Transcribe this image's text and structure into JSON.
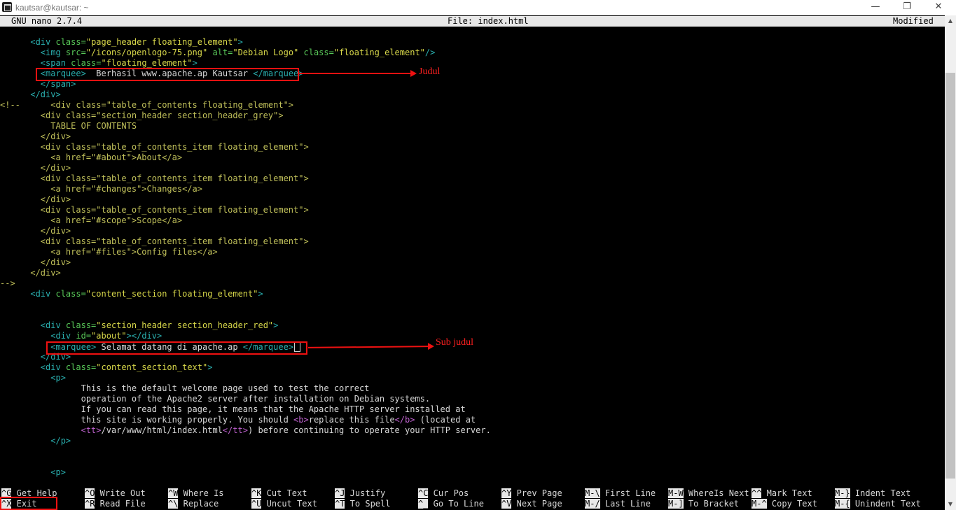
{
  "window": {
    "title": "kautsar@kautsar: ~",
    "minimize_glyph": "—",
    "restore_glyph": "❐",
    "close_glyph": "✕"
  },
  "nano": {
    "version": "GNU nano 2.7.4",
    "file": "File: index.html",
    "status": "Modified"
  },
  "editor_lines": [
    [
      [
        "c-tag",
        "      <div "
      ],
      [
        "c-attr",
        "class="
      ],
      [
        "c-str",
        "\"page_header floating_element\""
      ],
      [
        "c-tag",
        ">"
      ]
    ],
    [
      [
        "c-tag",
        "        <img "
      ],
      [
        "c-attr",
        "src="
      ],
      [
        "c-str",
        "\"/icons/openlogo-75.png\""
      ],
      [
        "c-attr",
        " alt="
      ],
      [
        "c-str",
        "\"Debian Logo\""
      ],
      [
        "c-attr",
        " class="
      ],
      [
        "c-str",
        "\"floating_element\""
      ],
      [
        "c-tag",
        "/>"
      ]
    ],
    [
      [
        "c-tag",
        "        <span "
      ],
      [
        "c-attr",
        "class="
      ],
      [
        "c-str",
        "\"floating_element\""
      ],
      [
        "c-tag",
        ">"
      ]
    ],
    [
      [
        "c-tag",
        "        <marquee>"
      ],
      [
        "c-txt",
        "  Berhasil www.apache.ap Kautsar "
      ],
      [
        "c-tag",
        "</marquee>"
      ]
    ],
    [
      [
        "c-tag",
        "        </span>"
      ]
    ],
    [
      [
        "c-tag",
        "      </div>"
      ]
    ],
    [
      [
        "c-com",
        "<!--      <div class=\"table_of_contents floating_element\">"
      ]
    ],
    [
      [
        "c-com",
        "        <div class=\"section_header section_header_grey\">"
      ]
    ],
    [
      [
        "c-com",
        "          TABLE OF CONTENTS"
      ]
    ],
    [
      [
        "c-com",
        "        </div>"
      ]
    ],
    [
      [
        "c-com",
        "        <div class=\"table_of_contents_item floating_element\">"
      ]
    ],
    [
      [
        "c-com",
        "          <a href=\"#about\">About</a>"
      ]
    ],
    [
      [
        "c-com",
        "        </div>"
      ]
    ],
    [
      [
        "c-com",
        "        <div class=\"table_of_contents_item floating_element\">"
      ]
    ],
    [
      [
        "c-com",
        "          <a href=\"#changes\">Changes</a>"
      ]
    ],
    [
      [
        "c-com",
        "        </div>"
      ]
    ],
    [
      [
        "c-com",
        "        <div class=\"table_of_contents_item floating_element\">"
      ]
    ],
    [
      [
        "c-com",
        "          <a href=\"#scope\">Scope</a>"
      ]
    ],
    [
      [
        "c-com",
        "        </div>"
      ]
    ],
    [
      [
        "c-com",
        "        <div class=\"table_of_contents_item floating_element\">"
      ]
    ],
    [
      [
        "c-com",
        "          <a href=\"#files\">Config files</a>"
      ]
    ],
    [
      [
        "c-com",
        "        </div>"
      ]
    ],
    [
      [
        "c-com",
        "      </div>"
      ]
    ],
    [
      [
        "c-com",
        "-->"
      ]
    ],
    [
      [
        "c-tag",
        "      <div "
      ],
      [
        "c-attr",
        "class="
      ],
      [
        "c-str",
        "\"content_section floating_element\""
      ],
      [
        "c-tag",
        ">"
      ]
    ],
    [],
    [],
    [
      [
        "c-tag",
        "        <div "
      ],
      [
        "c-attr",
        "class="
      ],
      [
        "c-str",
        "\"section_header section_header_red\""
      ],
      [
        "c-tag",
        ">"
      ]
    ],
    [
      [
        "c-tag",
        "          <div "
      ],
      [
        "c-attr",
        "id="
      ],
      [
        "c-str",
        "\"about\""
      ],
      [
        "c-tag",
        "></div>"
      ]
    ],
    [
      [
        "c-tag",
        "          <marquee>"
      ],
      [
        "c-txt",
        " Selamat datang di apache.ap "
      ],
      [
        "c-tag",
        "</marquee>"
      ]
    ],
    [
      [
        "c-tag",
        "        </div>"
      ]
    ],
    [
      [
        "c-tag",
        "        <div "
      ],
      [
        "c-attr",
        "class="
      ],
      [
        "c-str",
        "\"content_section_text\""
      ],
      [
        "c-tag",
        ">"
      ]
    ],
    [
      [
        "c-tag",
        "          <p>"
      ]
    ],
    [
      [
        "c-txt",
        "                This is the default welcome page used to test the correct"
      ]
    ],
    [
      [
        "c-txt",
        "                operation of the Apache2 server after installation on Debian systems."
      ]
    ],
    [
      [
        "c-txt",
        "                If you can read this page, it means that the Apache HTTP server installed at"
      ]
    ],
    [
      [
        "c-txt",
        "                this site is working properly. You should "
      ],
      [
        "c-tt",
        "<b>"
      ],
      [
        "c-txt",
        "replace this file"
      ],
      [
        "c-tt",
        "</b>"
      ],
      [
        "c-txt",
        " (located at"
      ]
    ],
    [
      [
        "c-txt",
        "                "
      ],
      [
        "c-tt",
        "<tt>"
      ],
      [
        "c-txt",
        "/var/www/html/index.html"
      ],
      [
        "c-tt",
        "</tt>"
      ],
      [
        "c-txt",
        ") before continuing to operate your HTTP server."
      ]
    ],
    [
      [
        "c-tag",
        "          </p>"
      ]
    ],
    [],
    [],
    [
      [
        "c-tag",
        "          <p>"
      ]
    ]
  ],
  "annotations": {
    "judul": "Judul",
    "sub_judul": "Sub judul"
  },
  "shortcuts": [
    {
      "key": "^G",
      "label": "Get Help"
    },
    {
      "key": "^O",
      "label": "Write Out"
    },
    {
      "key": "^W",
      "label": "Where Is"
    },
    {
      "key": "^K",
      "label": "Cut Text"
    },
    {
      "key": "^J",
      "label": "Justify"
    },
    {
      "key": "^C",
      "label": "Cur Pos"
    },
    {
      "key": "^Y",
      "label": "Prev Page"
    },
    {
      "key": "M-\\",
      "label": "First Line"
    },
    {
      "key": "M-W",
      "label": "WhereIs Next"
    },
    {
      "key": "^^",
      "label": "Mark Text"
    },
    {
      "key": "M-}",
      "label": "Indent Text"
    },
    {
      "key": "^X",
      "label": "Exit"
    },
    {
      "key": "^R",
      "label": "Read File"
    },
    {
      "key": "^\\",
      "label": "Replace"
    },
    {
      "key": "^U",
      "label": "Uncut Text"
    },
    {
      "key": "^T",
      "label": "To Spell"
    },
    {
      "key": "^_",
      "label": "Go To Line"
    },
    {
      "key": "^V",
      "label": "Next Page"
    },
    {
      "key": "M-/",
      "label": "Last Line"
    },
    {
      "key": "M-]",
      "label": "To Bracket"
    },
    {
      "key": "M-^",
      "label": "Copy Text"
    },
    {
      "key": "M-{",
      "label": "Unindent Text"
    }
  ]
}
